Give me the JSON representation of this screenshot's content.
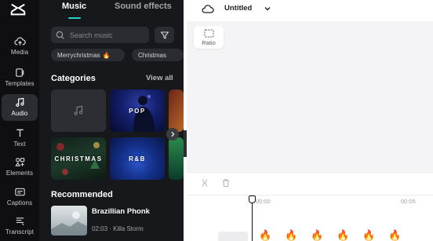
{
  "nav": {
    "items": [
      {
        "label": "Media",
        "active": false
      },
      {
        "label": "Templates",
        "active": false
      },
      {
        "label": "Audio",
        "active": true
      },
      {
        "label": "Text",
        "active": false
      },
      {
        "label": "Elements",
        "active": false
      },
      {
        "label": "Captions",
        "active": false
      },
      {
        "label": "Transcript",
        "active": false
      }
    ]
  },
  "panel": {
    "tabs": [
      {
        "label": "Music",
        "active": true
      },
      {
        "label": "Sound effects",
        "active": false
      }
    ],
    "search_placeholder": "Search music",
    "chips": [
      "Merrychristmas",
      "Christmas"
    ],
    "categories_title": "Categories",
    "view_all_label": "View all",
    "categories": [
      {
        "label": "",
        "icon": "music-note-icon"
      },
      {
        "label": "POP"
      },
      {
        "label": ""
      },
      {
        "label": "CHRISTMAS"
      },
      {
        "label": "R&B"
      },
      {
        "label": ""
      }
    ],
    "recommended_title": "Recommended",
    "recommended": [
      {
        "title": "Brazillian Phonk",
        "meta": "02:03 · Killa Storm"
      }
    ]
  },
  "editor": {
    "project_title": "Untitled",
    "ratio_label": "Ratio",
    "timeline": {
      "ticks": [
        "00:00",
        "00:05"
      ]
    },
    "track_emoji": "🔥"
  },
  "colors": {
    "accent": "#22d3c5",
    "panel_bg": "#17181c",
    "rail_bg": "#0f0f11"
  }
}
